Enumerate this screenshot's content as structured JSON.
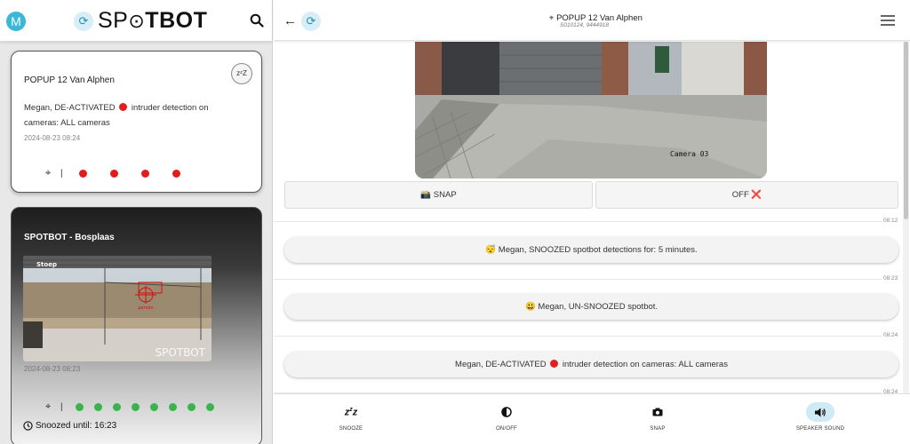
{
  "user": {
    "avatar_letter": "M"
  },
  "app": {
    "logo_light": "SP",
    "logo_mark": "⊙",
    "logo_bold": "TBOT"
  },
  "cards": [
    {
      "title": "POPUP 12 Van Alphen",
      "badge": "zᶻZ",
      "message_before": "Megan, DE-ACTIVATED",
      "message_after": "intruder detection on cameras: ALL cameras",
      "timestamp": "2024-08-23 08:24",
      "camera_status_color": "#e41b1b",
      "camera_count": 4
    },
    {
      "title": "SPOTBOT - Bosplaas",
      "snapshot_label": "Stoep",
      "snapshot_watermark": "SPOTBOT",
      "detection_label": "person",
      "timestamp": "2024-08-23 08:23",
      "camera_status_color": "#38b54a",
      "camera_count": 8,
      "snoozed_text": "Snoozed until: 16:23"
    }
  ],
  "site": {
    "title": "POPUP 12 Van Alphen",
    "coords": "S010124, 9444918",
    "camera_label": "Camera 03"
  },
  "actions": {
    "snap_label": "📸 SNAP",
    "off_label": "OFF ❌"
  },
  "feed": [
    {
      "time": "08:12",
      "text": "😴 Megan, SNOOZED spotbot detections for: 5 minutes."
    },
    {
      "time": "08:23",
      "text": "😃 Megan, UN-SNOOZED spotbot."
    },
    {
      "time": "08:24",
      "text_before": "Megan, DE-ACTIVATED",
      "text_after": "intruder detection on cameras: ALL cameras"
    },
    {
      "time": "08:24"
    }
  ],
  "toolbar": [
    {
      "label": "SNOOZE",
      "icon": "zzz-icon"
    },
    {
      "label": "ON/OFF",
      "icon": "contrast-icon"
    },
    {
      "label": "SNAP",
      "icon": "camera-icon"
    },
    {
      "label": "SPEAKER SOUND",
      "icon": "speaker-icon"
    }
  ]
}
